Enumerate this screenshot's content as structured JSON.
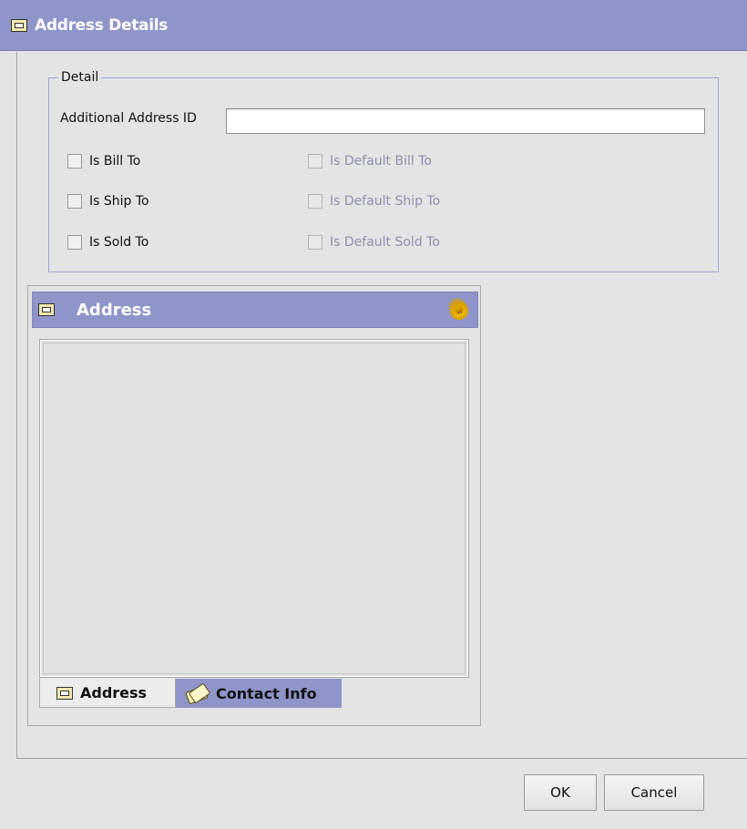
{
  "window": {
    "title": "Address Details",
    "icon": "address-card-icon"
  },
  "detail": {
    "legend": "Detail",
    "additional_address_id_label": "Additional Address ID",
    "additional_address_id_value": "",
    "checkboxes_left": [
      {
        "label": "Is Bill To",
        "checked": false,
        "enabled": true
      },
      {
        "label": "Is Ship To",
        "checked": false,
        "enabled": true
      },
      {
        "label": "Is Sold To",
        "checked": false,
        "enabled": true
      }
    ],
    "checkboxes_right": [
      {
        "label": "Is Default Bill To",
        "checked": false,
        "enabled": false
      },
      {
        "label": "Is Default Ship To",
        "checked": false,
        "enabled": false
      },
      {
        "label": "Is Default Sold To",
        "checked": false,
        "enabled": false
      }
    ]
  },
  "address_panel": {
    "title": "Address",
    "icon": "address-card-icon",
    "action_icon": "gear-icon",
    "tabs": [
      {
        "label": "Address",
        "icon": "address-card-icon",
        "active": true
      },
      {
        "label": "Contact Info",
        "icon": "contacts-icon",
        "active": false
      }
    ]
  },
  "buttons": {
    "ok": "OK",
    "cancel": "Cancel"
  },
  "colors": {
    "titlebar": "#8f95c8",
    "background": "#e4e4e4",
    "disabled_text": "#8c90ad"
  }
}
